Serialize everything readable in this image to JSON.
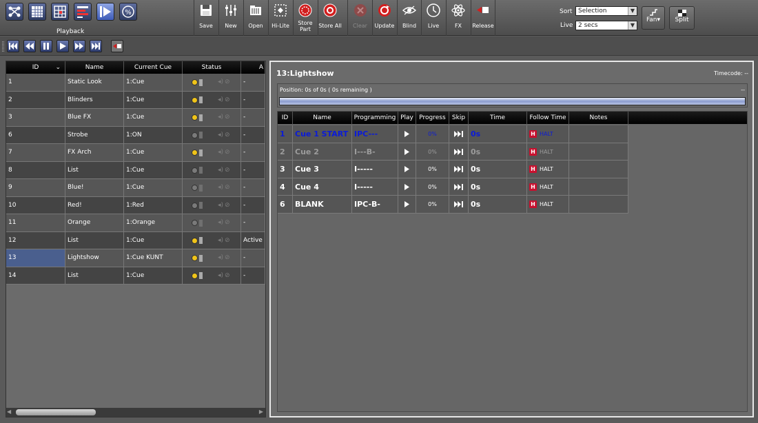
{
  "app": {
    "mode_label": "Playback"
  },
  "toolbar": {
    "tools": [
      {
        "label": "Save",
        "icon": "save-icon"
      },
      {
        "label": "New",
        "icon": "faders-icon"
      },
      {
        "label": "Open",
        "icon": "open-icon"
      },
      {
        "label": "Hi-Lite",
        "icon": "hilite-icon"
      },
      {
        "label": "Store Part",
        "icon": "store-part-icon"
      },
      {
        "label": "Store All",
        "icon": "store-all-icon"
      },
      {
        "label": "Clear",
        "icon": "clear-icon",
        "disabled": true
      },
      {
        "label": "Update",
        "icon": "update-icon"
      },
      {
        "label": "Blind",
        "icon": "eye-icon"
      },
      {
        "label": "Live",
        "icon": "clock-icon"
      },
      {
        "label": "FX",
        "icon": "atom-icon"
      },
      {
        "label": "Release",
        "icon": "release-icon"
      }
    ],
    "sort_label": "Sort",
    "sort_value": "Selection",
    "live_label": "Live",
    "live_value": "2 secs",
    "fan_label": "Fan",
    "split_label": "Split"
  },
  "playlist": {
    "headers": [
      "ID",
      "Name",
      "Current Cue",
      "Status",
      "A"
    ],
    "rows": [
      {
        "id": "1",
        "name": "Static Look",
        "cue": "1:Cue",
        "status": "on",
        "active": "-"
      },
      {
        "id": "2",
        "name": "Blinders",
        "cue": "1:Cue",
        "status": "on",
        "active": "-"
      },
      {
        "id": "3",
        "name": "Blue FX",
        "cue": "1:Cue",
        "status": "on",
        "active": "-"
      },
      {
        "id": "6",
        "name": "Strobe",
        "cue": "1:ON",
        "status": "off",
        "active": "-"
      },
      {
        "id": "7",
        "name": "FX Arch",
        "cue": "1:Cue",
        "status": "on",
        "active": "-"
      },
      {
        "id": "8",
        "name": "List",
        "cue": "1:Cue",
        "status": "off",
        "active": "-"
      },
      {
        "id": "9",
        "name": "Blue!",
        "cue": "1:Cue",
        "status": "off",
        "active": "-"
      },
      {
        "id": "10",
        "name": "Red!",
        "cue": "1:Red",
        "status": "off",
        "active": "-"
      },
      {
        "id": "11",
        "name": "Orange",
        "cue": "1:Orange",
        "status": "off",
        "active": "-"
      },
      {
        "id": "12",
        "name": "List",
        "cue": "1:Cue",
        "status": "on",
        "active": "Active"
      },
      {
        "id": "13",
        "name": "Lightshow",
        "cue": "1:Cue KUNT",
        "status": "on",
        "active": "-"
      },
      {
        "id": "14",
        "name": "List",
        "cue": "1:Cue",
        "status": "on",
        "active": "-"
      }
    ],
    "selected_index": 10
  },
  "detail": {
    "title": "13:Lightshow",
    "timecode": "Timecode: --",
    "position": "Position: 0s of 0s ( 0s remaining )",
    "position_dash": "--",
    "progress": 1.0,
    "headers": [
      "ID",
      "Name",
      "Programming",
      "Play",
      "Progress",
      "Skip",
      "Time",
      "Follow Time",
      "Notes"
    ],
    "cues": [
      {
        "id": "1",
        "name": "Cue 1 START",
        "prog": "IPC---",
        "progress": "0%",
        "time": "0s",
        "follow": "HALT",
        "state": "current"
      },
      {
        "id": "2",
        "name": "Cue 2",
        "prog": "I---B-",
        "progress": "0%",
        "time": "0s",
        "follow": "HALT",
        "state": "gray"
      },
      {
        "id": "3",
        "name": "Cue 3",
        "prog": "I-----",
        "progress": "0%",
        "time": "0s",
        "follow": "HALT",
        "state": "normal"
      },
      {
        "id": "4",
        "name": "Cue 4",
        "prog": "I-----",
        "progress": "0%",
        "time": "0s",
        "follow": "HALT",
        "state": "normal"
      },
      {
        "id": "6",
        "name": "BLANK",
        "prog": "IPC-B-",
        "progress": "0%",
        "time": "0s",
        "follow": "HALT",
        "state": "normal"
      }
    ]
  },
  "colors": {
    "current_cue": "#0b1bd8",
    "selected_row": "#4a5f8e",
    "halt": "#c8102e",
    "accent": "#e8e8e8"
  }
}
